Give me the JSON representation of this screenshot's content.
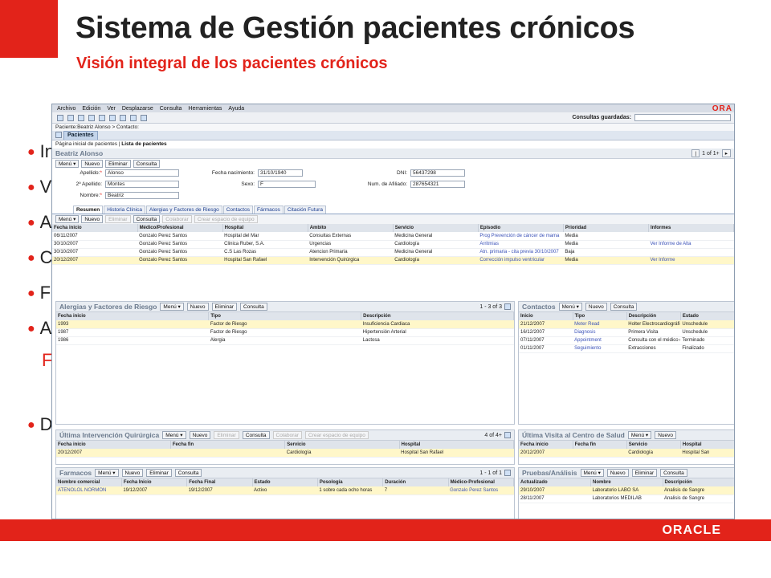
{
  "slide": {
    "title": "Sistema de Gestión pacientes crónicos",
    "subtitle": "Visión integral de los pacientes crónicos",
    "bullets": [
      "In",
      "V",
      "A",
      "C",
      "F",
      "A",
      "F",
      "D"
    ]
  },
  "footer": {
    "logo": "ORACLE"
  },
  "colors": {
    "accent": "#e2231a",
    "link": "#3b52b8",
    "selected_row": "#fff7c9"
  },
  "app": {
    "menu": [
      "Archivo",
      "Edición",
      "Ver",
      "Desplazarse",
      "Consulta",
      "Herramientas",
      "Ayuda"
    ],
    "menu_logo": "ORA",
    "toolbar": {
      "saved_label": "Consultas guardadas:",
      "saved_value": ""
    },
    "breadcrumb": "Paciente:Beatriz Alonso  > Contacto:",
    "tab": "Pacientes",
    "subnav": {
      "home": "Página inicial de pacientes",
      "list": "Lista de pacientes"
    },
    "patient": {
      "name": "Beatriz Alonso",
      "pager": "1 of 1+",
      "labels": {
        "apellido": "Apellido:",
        "apellido2": "2º Apellido:",
        "nombre": "Nombre:",
        "fecha": "Fecha nacimiento:",
        "sexo": "Sexo:",
        "dni": "DNI:",
        "afiliado": "Num. de Afiliado:"
      },
      "values": {
        "apellido": "Alonso",
        "apellido2": "Montes",
        "nombre": "Beatriz",
        "fecha": "31/10/1940",
        "sexo": "F",
        "dni": "56437298",
        "afiliado": "287654321"
      }
    },
    "buttons": {
      "menu": "Menú ▾",
      "nuevo": "Nuevo",
      "eliminar": "Eliminar",
      "consulta": "Consulta",
      "colaborar": "Colaborar",
      "crear": "Crear espacio de equipo"
    },
    "detail_tabs": [
      "Resumen",
      "Historia Clínica",
      "Alergias y Factores de Riesgo",
      "Contactos",
      "Fármacos",
      "Citación Futura"
    ],
    "episodes": {
      "headers": [
        "Fecha inicio",
        "Médico/Profesional",
        "Hospital",
        "Ambito",
        "Servicio",
        "Episodio",
        "Prioridad",
        "Informes"
      ],
      "rows": [
        [
          "06/11/2007",
          "Gonzalo Perez Santos",
          "Hospital del Mar",
          "Consultas Externas",
          "Medicina General",
          "Prog Prevención de cáncer de mama",
          "Media",
          ""
        ],
        [
          "30/10/2007",
          "Gonzalo Perez Santos",
          "Clinica Ruber, S.A.",
          "Urgencias",
          "Cardiología",
          "Arritmias",
          "Media",
          "Ver Informe de Alta"
        ],
        [
          "30/10/2007",
          "Gonzalo Perez Santos",
          "C.S Las Rozas",
          "Atencion Primaria",
          "Medicina General",
          "Atn. primaria - cita previa 30/10/2007",
          "Baja",
          ""
        ],
        [
          "20/12/2007",
          "Gonzalo Perez Santos",
          "Hospital San Rafael",
          "Intervención Quirúrgica",
          "Cardiología",
          "Corrección impulso ventricular",
          "Media",
          "Ver Informe"
        ]
      ]
    },
    "alergias": {
      "title": "Alergias y Factores de Riesgo",
      "pager": "1 - 3 of 3",
      "headers": [
        "Fecha inicio",
        "Tipo",
        "Descripción"
      ],
      "rows": [
        [
          "1993",
          "Factor de Riesgo",
          "Insuficiencia Cardiaca"
        ],
        [
          "1987",
          "Factor de Riesgo",
          "Hipertensión Arterial"
        ],
        [
          "1986",
          "Alergia",
          "Lactosa"
        ]
      ]
    },
    "contactos": {
      "title": "Contactos",
      "headers": [
        "Inicio",
        "Tipo",
        "Descripción",
        "Estado"
      ],
      "rows": [
        [
          "21/12/2007",
          "Meter Read",
          "Holter Electrocardiográfico",
          "Unschedule"
        ],
        [
          "16/12/2007",
          "Diagnosis",
          "Primera Visita",
          "Unschedule"
        ],
        [
          "07/11/2007",
          "Appointment",
          "Consulta con el médico de fam",
          "Terminado"
        ],
        [
          "01/11/2007",
          "Seguimiento",
          "Extracciones",
          "Finalizado"
        ]
      ]
    },
    "intervencion": {
      "title": "Última Intervención Quirúrgica",
      "pager": "4 of 4+",
      "headers": [
        "Fecha inicio",
        "Fecha fin",
        "Servicio",
        "Hospital"
      ],
      "rows": [
        [
          "20/12/2007",
          "",
          "Cardiología",
          "Hospital San Rafael"
        ]
      ]
    },
    "visita": {
      "title": "Última Visita al Centro de Salud",
      "headers": [
        "Fecha inicio",
        "Fecha fin",
        "Servicio",
        "Hospital"
      ],
      "rows": [
        [
          "20/12/2007",
          "",
          "Cardiología",
          "Hospital San"
        ]
      ]
    },
    "farmacos": {
      "title": "Farmacos",
      "pager": "1 - 1 of 1",
      "headers": [
        "Nombre comercial",
        "Fecha Inicio",
        "Fecha Final",
        "Estado",
        "Posología",
        "Duración",
        "Médico-Profesional"
      ],
      "rows": [
        [
          "ATENOLOL NORMON",
          "19/12/2007",
          "19/12/2007",
          "Activo",
          "1 sobre cada ocho horas",
          "7",
          "Gonzalo Perez Santos"
        ]
      ]
    },
    "pruebas": {
      "title": "Pruebas/Análisis",
      "headers": [
        "Actualizado",
        "Nombre",
        "Descripción"
      ],
      "rows": [
        [
          "29/10/2007",
          "Laboratorio LABO SA",
          "Analisis de Sangre"
        ],
        [
          "28/11/2007",
          "Laboratorios MEDILAB",
          "Analisis de Sangre"
        ]
      ]
    }
  }
}
